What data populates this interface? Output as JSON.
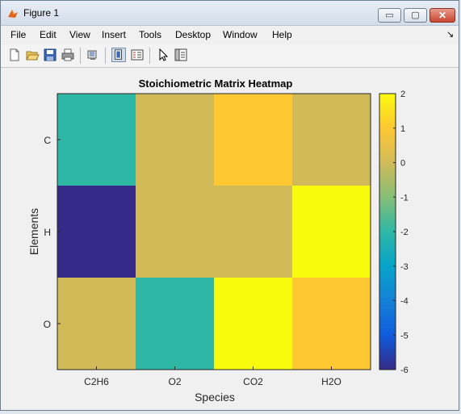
{
  "window": {
    "title": "Figure 1",
    "minimize_label": "▭",
    "maximize_label": "▢",
    "close_label": "✕"
  },
  "menubar": {
    "items": [
      "File",
      "Edit",
      "View",
      "Insert",
      "Tools",
      "Desktop",
      "Window",
      "Help"
    ],
    "overflow_icon": "arrow-icon"
  },
  "toolbar": {
    "buttons": [
      "new-figure-icon",
      "open-file-icon",
      "save-icon",
      "print-icon",
      "link-plot-icon",
      "dock-icon",
      "insert-legend-icon",
      "pointer-icon",
      "property-inspector-icon"
    ]
  },
  "colors": {
    "titlebar": "#d3dde9",
    "close_button": "#c7462f"
  },
  "chart_data": {
    "type": "heatmap",
    "title": "Stoichiometric Matrix Heatmap",
    "xlabel": "Species",
    "ylabel": "Elements",
    "x_categories": [
      "C2H6",
      "O2",
      "CO2",
      "H2O"
    ],
    "y_categories": [
      "C",
      "H",
      "O"
    ],
    "values": [
      [
        -2,
        0,
        1,
        0
      ],
      [
        -6,
        0,
        0,
        2
      ],
      [
        0,
        -2,
        2,
        1
      ]
    ],
    "colorbar": {
      "min": -6,
      "max": 2,
      "ticks": [
        "2",
        "1",
        "0",
        "-1",
        "-2",
        "-3",
        "-4",
        "-5",
        "-6"
      ]
    },
    "colormap": "parula"
  }
}
